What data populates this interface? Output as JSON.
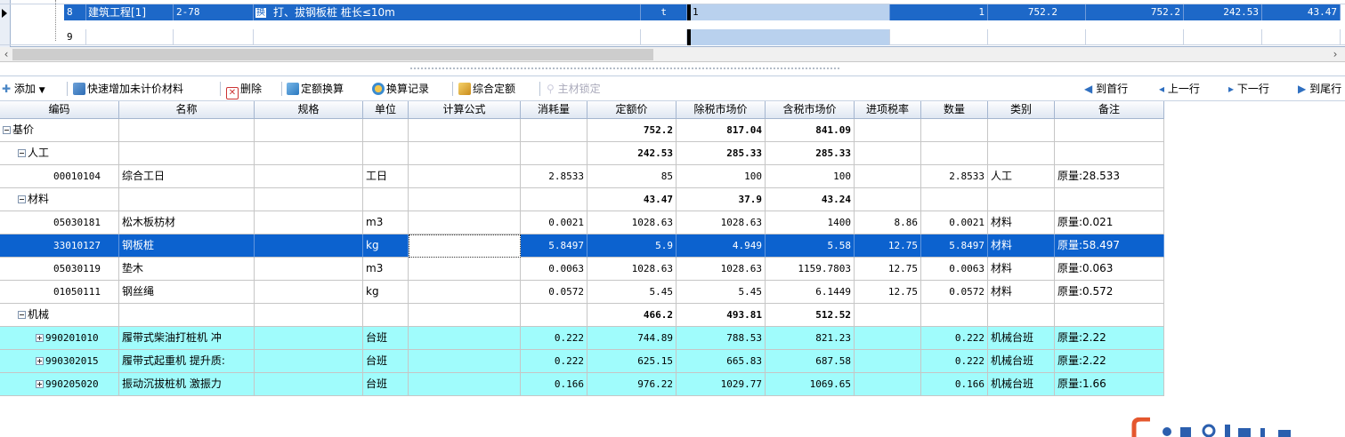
{
  "top_table": {
    "row8": {
      "index": "8",
      "type": "建筑工程[1]",
      "code": "2-78",
      "flag": "换",
      "name": "打、拔钢板桩 桩长≤10m",
      "unit": "t",
      "expr": "1",
      "qty": "1",
      "price1": "752.2",
      "price2": "752.2",
      "labor": "242.53",
      "material": "43.47"
    },
    "row9": {
      "index": "9"
    }
  },
  "toolbar": {
    "add": "添加",
    "quick_add": "快速增加未计价材料",
    "delete": "删除",
    "quota_convert": "定额换算",
    "convert_log": "换算记录",
    "composite_quota": "综合定额",
    "lock_main": "主材锁定",
    "first": "到首行",
    "prev": "上一行",
    "next": "下一行",
    "last": "到尾行"
  },
  "grid": {
    "headers": [
      "编码",
      "名称",
      "规格",
      "单位",
      "计算公式",
      "消耗量",
      "定额价",
      "除税市场价",
      "含税市场价",
      "进项税率",
      "数量",
      "类别",
      "备注"
    ],
    "rows": [
      {
        "code": "基价",
        "name": "",
        "spec": "",
        "unit": "",
        "formula": "",
        "consumption": "",
        "quota": "752.2",
        "ex_tax": "817.04",
        "inc_tax": "841.09",
        "tax": "",
        "qty": "",
        "category": "",
        "remark": ""
      },
      {
        "code": "人工",
        "name": "",
        "spec": "",
        "unit": "",
        "formula": "",
        "consumption": "",
        "quota": "242.53",
        "ex_tax": "285.33",
        "inc_tax": "285.33",
        "tax": "",
        "qty": "",
        "category": "",
        "remark": ""
      },
      {
        "code": "00010104",
        "name": "综合工日",
        "spec": "",
        "unit": "工日",
        "formula": "",
        "consumption": "2.8533",
        "quota": "85",
        "ex_tax": "100",
        "inc_tax": "100",
        "tax": "",
        "qty": "2.8533",
        "category": "人工",
        "remark": "原量:28.533"
      },
      {
        "code": "材料",
        "name": "",
        "spec": "",
        "unit": "",
        "formula": "",
        "consumption": "",
        "quota": "43.47",
        "ex_tax": "37.9",
        "inc_tax": "43.24",
        "tax": "",
        "qty": "",
        "category": "",
        "remark": ""
      },
      {
        "code": "05030181",
        "name": "松木板枋材",
        "spec": "",
        "unit": "m3",
        "formula": "",
        "consumption": "0.0021",
        "quota": "1028.63",
        "ex_tax": "1028.63",
        "inc_tax": "1400",
        "tax": "8.86",
        "qty": "0.0021",
        "category": "材料",
        "remark": "原量:0.021"
      },
      {
        "code": "33010127",
        "name": "钢板桩",
        "spec": "",
        "unit": "kg",
        "formula": "",
        "consumption": "5.8497",
        "quota": "5.9",
        "ex_tax": "4.949",
        "inc_tax": "5.58",
        "tax": "12.75",
        "qty": "5.8497",
        "category": "材料",
        "remark": "原量:58.497"
      },
      {
        "code": "05030119",
        "name": "垫木",
        "spec": "",
        "unit": "m3",
        "formula": "",
        "consumption": "0.0063",
        "quota": "1028.63",
        "ex_tax": "1028.63",
        "inc_tax": "1159.7803",
        "tax": "12.75",
        "qty": "0.0063",
        "category": "材料",
        "remark": "原量:0.063"
      },
      {
        "code": "01050111",
        "name": "钢丝绳",
        "spec": "",
        "unit": "kg",
        "formula": "",
        "consumption": "0.0572",
        "quota": "5.45",
        "ex_tax": "5.45",
        "inc_tax": "6.1449",
        "tax": "12.75",
        "qty": "0.0572",
        "category": "材料",
        "remark": "原量:0.572"
      },
      {
        "code": "机械",
        "name": "",
        "spec": "",
        "unit": "",
        "formula": "",
        "consumption": "",
        "quota": "466.2",
        "ex_tax": "493.81",
        "inc_tax": "512.52",
        "tax": "",
        "qty": "",
        "category": "",
        "remark": ""
      },
      {
        "code": "990201010",
        "name": "履带式柴油打桩机 冲",
        "spec": "",
        "unit": "台班",
        "formula": "",
        "consumption": "0.222",
        "quota": "744.89",
        "ex_tax": "788.53",
        "inc_tax": "821.23",
        "tax": "",
        "qty": "0.222",
        "category": "机械台班",
        "remark": "原量:2.22"
      },
      {
        "code": "990302015",
        "name": "履带式起重机 提升质:",
        "spec": "",
        "unit": "台班",
        "formula": "",
        "consumption": "0.222",
        "quota": "625.15",
        "ex_tax": "665.83",
        "inc_tax": "687.58",
        "tax": "",
        "qty": "0.222",
        "category": "机械台班",
        "remark": "原量:2.22"
      },
      {
        "code": "990205020",
        "name": "振动沉拔桩机 激振力",
        "spec": "",
        "unit": "台班",
        "formula": "",
        "consumption": "0.166",
        "quota": "976.22",
        "ex_tax": "1029.77",
        "inc_tax": "1069.65",
        "tax": "",
        "qty": "0.166",
        "category": "机械台班",
        "remark": "原量:1.66"
      }
    ]
  },
  "colors": {
    "selection": "#0c62cf",
    "machine_row": "#a0fcfc",
    "accent": "#1d68c8"
  }
}
